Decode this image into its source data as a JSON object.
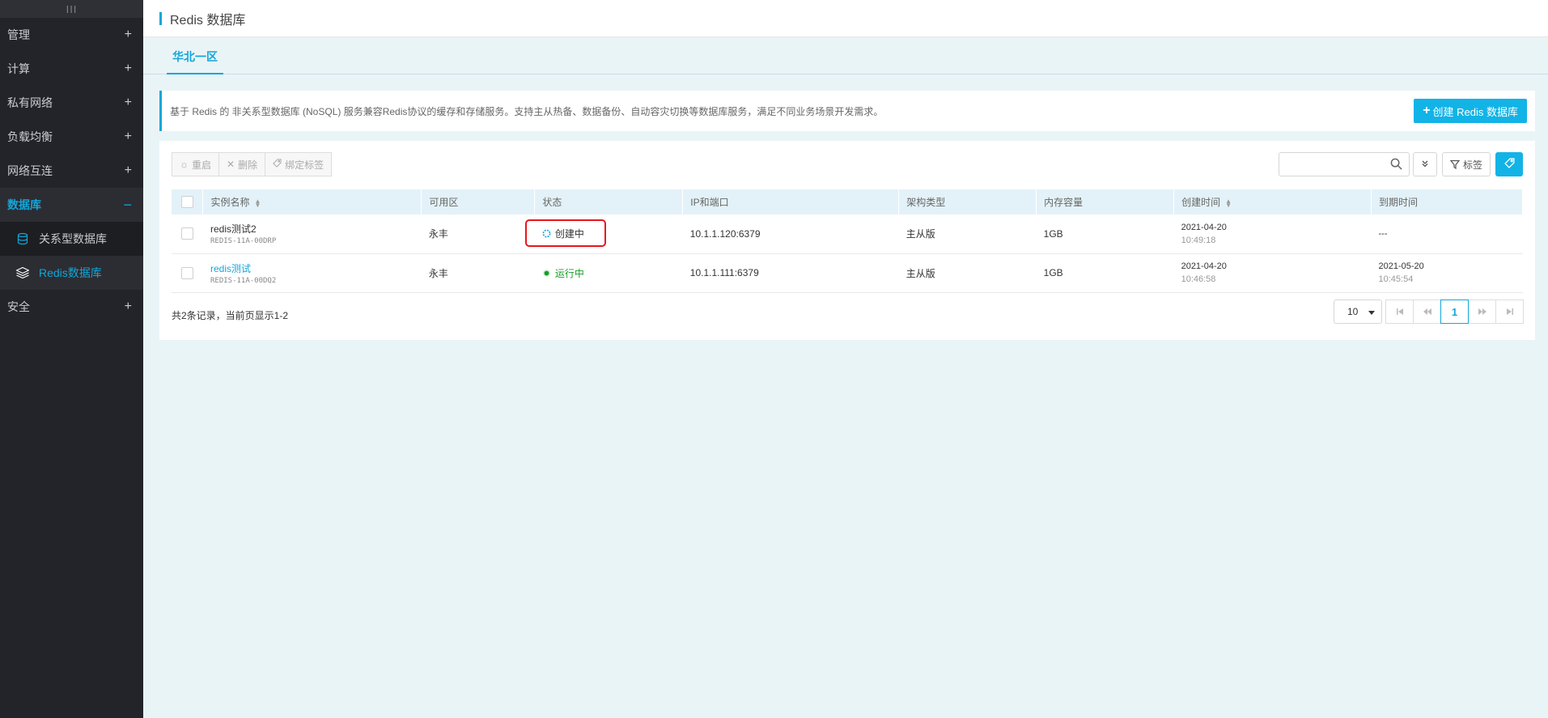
{
  "header": {
    "title": "Redis 数据库"
  },
  "sidebar": {
    "handle": "III",
    "items": [
      {
        "label": "管理",
        "sign": "+"
      },
      {
        "label": "计算",
        "sign": "+"
      },
      {
        "label": "私有网络",
        "sign": "+"
      },
      {
        "label": "负载均衡",
        "sign": "+"
      },
      {
        "label": "网络互连",
        "sign": "+"
      },
      {
        "label": "数据库",
        "sign": "−"
      }
    ],
    "subitems": [
      {
        "label": "关系型数据库",
        "icon": "database-icon"
      },
      {
        "label": "Redis数据库",
        "icon": "layers-icon"
      }
    ],
    "after": {
      "label": "安全",
      "sign": "+"
    }
  },
  "tabs": [
    {
      "label": "华北一区"
    }
  ],
  "banner": {
    "description": "基于 Redis 的 非关系型数据库 (NoSQL) 服务兼容Redis协议的缓存和存储服务。支持主从热备、数据备份、自动容灾切换等数据库服务，满足不同业务场景开发需求。",
    "create_button": "创建 Redis 数据库"
  },
  "toolbar": {
    "restart": "重启",
    "delete": "删除",
    "bind_tag": "绑定标签",
    "tag_filter": "标签",
    "search_placeholder": ""
  },
  "table": {
    "columns": [
      "实例名称",
      "可用区",
      "状态",
      "IP和端口",
      "架构类型",
      "内存容量",
      "创建时间",
      "到期时间"
    ],
    "rows": [
      {
        "name": "redis测试2",
        "id": "REDIS-11A-00DRP",
        "zone": "永丰",
        "status": "创建中",
        "ip": "10.1.1.120:6379",
        "arch": "主从版",
        "memory": "1GB",
        "created_date": "2021-04-20",
        "created_time": "10:49:18",
        "expire_date": "---",
        "expire_time": ""
      },
      {
        "name": "redis测试",
        "id": "REDIS-11A-00DQ2",
        "zone": "永丰",
        "status": "运行中",
        "ip": "10.1.1.111:6379",
        "arch": "主从版",
        "memory": "1GB",
        "created_date": "2021-04-20",
        "created_time": "10:46:58",
        "expire_date": "2021-05-20",
        "expire_time": "10:45:54"
      }
    ]
  },
  "footer": {
    "count_text": "共2条记录，当前页显示1-2",
    "page_size": "10",
    "current_page": "1"
  },
  "colors": {
    "accent": "#12a6d9",
    "sidebar_bg": "#222429",
    "running": "#1a9d2a",
    "highlight": "#e8161c"
  }
}
